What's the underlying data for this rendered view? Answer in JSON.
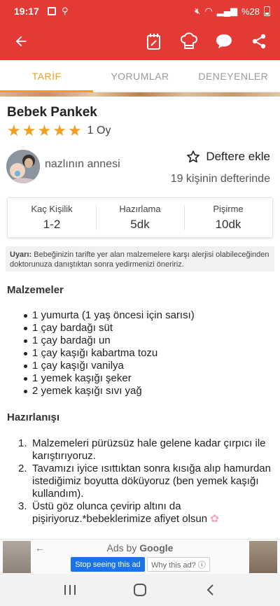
{
  "status_bar": {
    "time": "19:17",
    "battery": "%28"
  },
  "tabs": [
    {
      "label": "TARİF",
      "active": true
    },
    {
      "label": "YORUMLAR",
      "active": false
    },
    {
      "label": "DENEYENLER",
      "active": false
    }
  ],
  "recipe": {
    "title": "Bebek Pankek",
    "stars": 5,
    "rating_label": "1 Oy",
    "author": "nazlının annesi",
    "bookmark_label": "Deftere ekle",
    "bookmark_count": "19 kişinin defterinde"
  },
  "info": {
    "servings": {
      "label": "Kaç Kişilik",
      "value": "1-2"
    },
    "prep": {
      "label": "Hazırlama",
      "value": "5dk"
    },
    "cook": {
      "label": "Pişirme",
      "value": "10dk"
    }
  },
  "warning": {
    "label": "Uyarı:",
    "text": " Bebeğinizin tarifte yer alan malzemelere karşı alerjisi olabileceğinden doktorunuza danıştıktan sonra yedirmenizi öneririz."
  },
  "ingredients": {
    "title": "Malzemeler",
    "items": [
      "1 yumurta (1 yaş öncesi için sarısı)",
      "1 çay bardağı süt",
      "1 çay bardağı un",
      "1 çay kaşığı kabartma tozu",
      "1 çay kaşığı vanilya",
      "1 yemek kaşığı şeker",
      "2 yemek kaşığı sıvı yağ"
    ]
  },
  "preparation": {
    "title": "Hazırlanışı",
    "steps": [
      {
        "num": "1.",
        "text": "Malzemeleri pürüzsüz hale gelene kadar çırpıcı ile karıştırıyoruz."
      },
      {
        "num": "2.",
        "text": "Tavamızı iyice ısıttıktan sonra kısığa alıp hamurdan istediğimiz boyutta döküyoruz (ben yemek kaşığı kullandım)."
      },
      {
        "num": "3.",
        "text": "Üstü göz olunca çevirip altını da pişiriyoruz.*bebeklerimize afiyet olsun"
      }
    ]
  },
  "ad": {
    "label_prefix": "Ads by ",
    "label_brand": "Google",
    "stop_button": "Stop seeing this ad",
    "why_button": "Why this ad? ⓘ"
  },
  "colors": {
    "brand": "#e53935",
    "accent": "#f0a020"
  },
  "icons": [
    "back-arrow-icon",
    "notebook-icon",
    "chef-hat-icon",
    "chat-bubble-icon",
    "share-icon",
    "star-outline-icon"
  ]
}
